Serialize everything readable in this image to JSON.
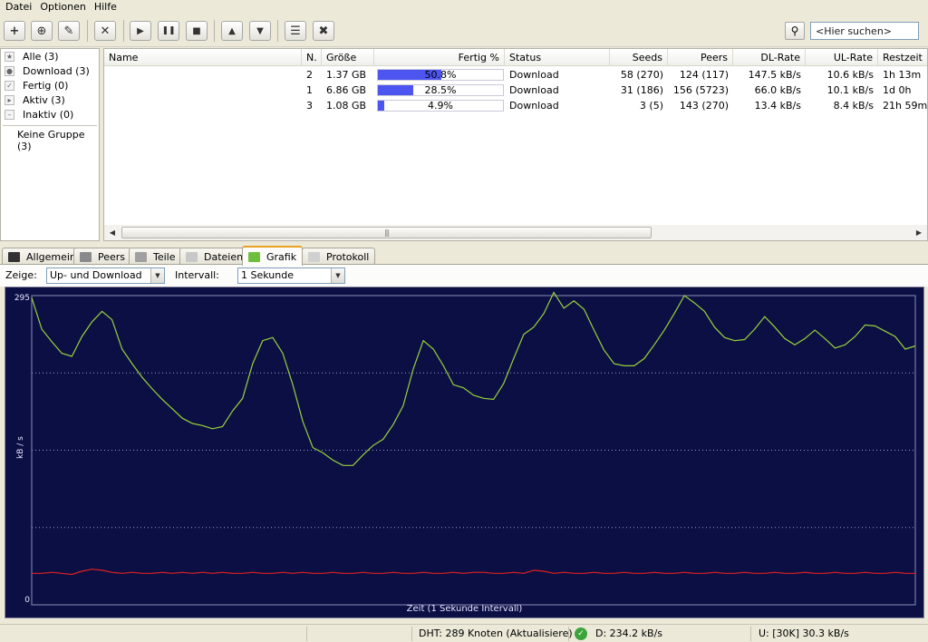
{
  "menu": [
    "Datei",
    "Optionen",
    "Hilfe"
  ],
  "toolbar": {
    "buttons": [
      {
        "name": "add-torrent-button",
        "icon": "plus-icon",
        "glyph": "+"
      },
      {
        "name": "add-url-button",
        "icon": "add-download-icon",
        "glyph": "⊕"
      },
      {
        "name": "create-torrent-button",
        "icon": "wand-icon",
        "glyph": "✎"
      },
      {
        "name": "remove-button",
        "icon": "close-icon",
        "glyph": "✕"
      },
      {
        "name": "start-button",
        "icon": "play-icon",
        "glyph": "▶"
      },
      {
        "name": "pause-button",
        "icon": "pause-icon",
        "glyph": "❚❚"
      },
      {
        "name": "stop-button",
        "icon": "stop-icon",
        "glyph": "■"
      },
      {
        "name": "move-up-button",
        "icon": "arrow-up-icon",
        "glyph": "▲"
      },
      {
        "name": "move-down-button",
        "icon": "arrow-down-icon",
        "glyph": "▼"
      },
      {
        "name": "rss-button",
        "icon": "rss-icon",
        "glyph": "☰"
      },
      {
        "name": "settings-button",
        "icon": "tools-icon",
        "glyph": "✖"
      }
    ],
    "search_placeholder": "<Hier suchen>"
  },
  "sidebar": {
    "items": [
      {
        "label": "Alle (3)",
        "icon": "star-icon",
        "glyph": "★"
      },
      {
        "label": "Download (3)",
        "icon": "download-dot-icon",
        "glyph": "●"
      },
      {
        "label": "Fertig (0)",
        "icon": "check-icon",
        "glyph": "✓"
      },
      {
        "label": "Aktiv (3)",
        "icon": "play-small-icon",
        "glyph": "▸"
      },
      {
        "label": "Inaktiv (0)",
        "icon": "minus-icon",
        "glyph": "–"
      }
    ],
    "group": "Keine Gruppe (3)"
  },
  "table": {
    "headers": {
      "name": "Name",
      "num": "N.",
      "size": "Größe",
      "done": "Fertig %",
      "status": "Status",
      "seeds": "Seeds",
      "peers": "Peers",
      "dl": "DL-Rate",
      "ul": "UL-Rate",
      "eta": "Restzeit"
    },
    "rows": [
      {
        "name": "",
        "num": "2",
        "size": "1.37 GB",
        "progress": 0.508,
        "progress_text": "50.8%",
        "status": "Download",
        "seeds": "58 (270)",
        "peers": "124 (117)",
        "dl": "147.5 kB/s",
        "ul": "10.6 kB/s",
        "eta": "1h 13m"
      },
      {
        "name": "",
        "num": "1",
        "size": "6.86 GB",
        "progress": 0.285,
        "progress_text": "28.5%",
        "status": "Download",
        "seeds": "31 (186)",
        "peers": "156 (5723)",
        "dl": "66.0 kB/s",
        "ul": "10.1 kB/s",
        "eta": "1d 0h"
      },
      {
        "name": "",
        "num": "3",
        "size": "1.08 GB",
        "progress": 0.049,
        "progress_text": "4.9%",
        "status": "Download",
        "seeds": "3 (5)",
        "peers": "143 (270)",
        "dl": "13.4 kB/s",
        "ul": "8.4 kB/s",
        "eta": "21h 59m"
      }
    ]
  },
  "tabs": [
    {
      "label": "Allgemein",
      "icon": "monitor-icon",
      "color": "#333333"
    },
    {
      "label": "Peers",
      "icon": "peers-icon",
      "color": "#8a8a8a"
    },
    {
      "label": "Teile",
      "icon": "pieces-icon",
      "color": "#a0a0a0"
    },
    {
      "label": "Dateien",
      "icon": "file-icon",
      "color": "#c8c8c8"
    },
    {
      "label": "Grafik",
      "icon": "graph-icon",
      "color": "#6fbf3f",
      "active": true
    },
    {
      "label": "Protokoll",
      "icon": "log-icon",
      "color": "#d0d0d0"
    }
  ],
  "graph_controls": {
    "show_label": "Zeige:",
    "show_value": "Up- und Download",
    "interval_label": "Intervall:",
    "interval_value": "1 Sekunde"
  },
  "chart_data": {
    "type": "line",
    "xlabel": "Zeit (1 Sekunde Intervall)",
    "ylabel": "kB / s",
    "ylim": [
      0,
      295
    ],
    "y_ticks": [
      "295",
      "0"
    ],
    "grid": true,
    "colors": {
      "download": "#9bd13a",
      "upload": "#e02020",
      "background": "#0b0f44"
    },
    "series": [
      {
        "key": "download",
        "values": [
          293,
          263,
          251,
          240,
          237,
          256,
          270,
          280,
          272,
          244,
          230,
          217,
          206,
          196,
          187,
          178,
          173,
          171,
          168,
          170,
          185,
          197,
          230,
          252,
          255,
          240,
          210,
          175,
          150,
          145,
          138,
          133,
          133,
          143,
          152,
          158,
          172,
          190,
          225,
          252,
          244,
          228,
          210,
          207,
          200,
          197,
          196,
          211,
          235,
          258,
          265,
          278,
          298,
          283,
          290,
          282,
          262,
          243,
          230,
          228,
          228,
          235,
          248,
          262,
          278,
          295,
          288,
          280,
          265,
          255,
          252,
          253,
          263,
          275,
          265,
          254,
          248,
          254,
          262,
          254,
          245,
          248,
          256,
          267,
          266,
          261,
          256,
          244,
          247
        ]
      },
      {
        "key": "upload",
        "values": [
          30,
          30,
          31,
          30,
          29,
          32,
          34,
          33,
          31,
          30,
          31,
          30,
          30,
          31,
          30,
          31,
          30,
          31,
          30,
          31,
          30,
          30,
          31,
          30,
          30,
          31,
          30,
          31,
          30,
          30,
          31,
          30,
          30,
          31,
          30,
          30,
          31,
          30,
          30,
          31,
          30,
          30,
          31,
          30,
          31,
          31,
          30,
          30,
          31,
          30,
          33,
          32,
          30,
          31,
          30,
          30,
          31,
          30,
          30,
          31,
          30,
          30,
          31,
          30,
          30,
          31,
          30,
          30,
          31,
          30,
          30,
          31,
          30,
          30,
          31,
          30,
          30,
          31,
          30,
          30,
          31,
          30,
          30,
          31,
          30,
          30,
          31,
          30,
          30
        ]
      }
    ]
  },
  "statusbar": {
    "dht": "DHT: 289 Knoten (Aktualisiere)",
    "download": "D: 234.2 kB/s",
    "upload": "U: [30K] 30.3 kB/s"
  }
}
